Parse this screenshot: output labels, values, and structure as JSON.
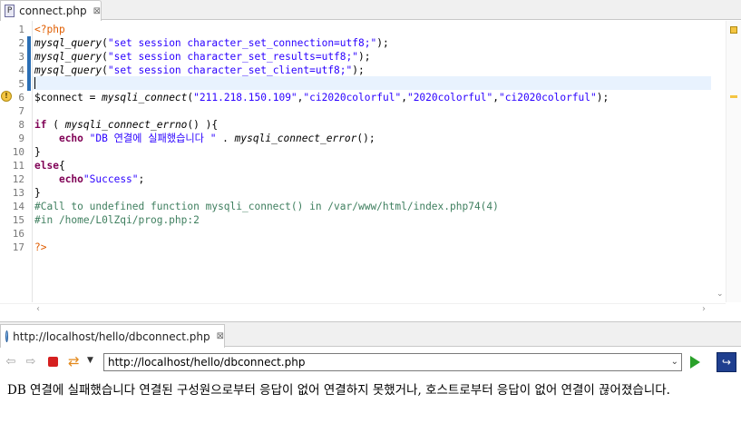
{
  "editor": {
    "tab_label": "connect.php",
    "tab_close_glyph": "⊠",
    "file_icon_letter": "P",
    "line_numbers": [
      "1",
      "2",
      "3",
      "4",
      "5",
      "6",
      "7",
      "8",
      "9",
      "10",
      "11",
      "12",
      "13",
      "14",
      "15",
      "16",
      "17"
    ],
    "lines": [
      [
        {
          "t": "<?php",
          "c": "tag"
        }
      ],
      [
        {
          "t": "mysql_query",
          "c": "fn"
        },
        {
          "t": "(",
          "c": "var"
        },
        {
          "t": "\"set session character_set_connection=utf8;\"",
          "c": "str"
        },
        {
          "t": ");",
          "c": "var"
        }
      ],
      [
        {
          "t": "mysql_query",
          "c": "fn"
        },
        {
          "t": "(",
          "c": "var"
        },
        {
          "t": "\"set session character_set_results=utf8;\"",
          "c": "str"
        },
        {
          "t": ");",
          "c": "var"
        }
      ],
      [
        {
          "t": "mysql_query",
          "c": "fn"
        },
        {
          "t": "(",
          "c": "var"
        },
        {
          "t": "\"set session character_set_client=utf8;\"",
          "c": "str"
        },
        {
          "t": ");",
          "c": "var"
        }
      ],
      [],
      [
        {
          "t": "$connect",
          "c": "var"
        },
        {
          "t": " = ",
          "c": "var"
        },
        {
          "t": "mysqli_connect",
          "c": "fn"
        },
        {
          "t": "(",
          "c": "var"
        },
        {
          "t": "\"211.218.150.109\"",
          "c": "str"
        },
        {
          "t": ",",
          "c": "var"
        },
        {
          "t": "\"ci2020colorful\"",
          "c": "str"
        },
        {
          "t": ",",
          "c": "var"
        },
        {
          "t": "\"2020colorful\"",
          "c": "str"
        },
        {
          "t": ",",
          "c": "var"
        },
        {
          "t": "\"ci2020colorful\"",
          "c": "str"
        },
        {
          "t": ");",
          "c": "var"
        }
      ],
      [],
      [
        {
          "t": "if",
          "c": "kw"
        },
        {
          "t": " ( ",
          "c": "var"
        },
        {
          "t": "mysqli_connect_errno",
          "c": "fn"
        },
        {
          "t": "() ){",
          "c": "var"
        }
      ],
      [
        {
          "t": "    ",
          "c": "var"
        },
        {
          "t": "echo",
          "c": "kw"
        },
        {
          "t": " ",
          "c": "var"
        },
        {
          "t": "\"DB 연결에 실패했습니다 \"",
          "c": "str"
        },
        {
          "t": " . ",
          "c": "var"
        },
        {
          "t": "mysqli_connect_error",
          "c": "fn"
        },
        {
          "t": "();",
          "c": "var"
        }
      ],
      [
        {
          "t": "}",
          "c": "var"
        }
      ],
      [
        {
          "t": "else",
          "c": "kw"
        },
        {
          "t": "{",
          "c": "var"
        }
      ],
      [
        {
          "t": "    ",
          "c": "var"
        },
        {
          "t": "echo",
          "c": "kw"
        },
        {
          "t": "\"Success\"",
          "c": "str"
        },
        {
          "t": ";",
          "c": "var"
        }
      ],
      [
        {
          "t": "}",
          "c": "var"
        }
      ],
      [
        {
          "t": "#Call to undefined function mysqli_connect() in /var/www/html/index.php74(4)",
          "c": "cmt"
        }
      ],
      [
        {
          "t": "#in /home/L0lZqi/prog.php:2",
          "c": "cmt"
        }
      ],
      [],
      [
        {
          "t": "?>",
          "c": "tag"
        }
      ]
    ]
  },
  "browser": {
    "tab_label": "http://localhost/hello/dbconnect.php",
    "tab_close_glyph": "⊠",
    "url_value": "http://localhost/hello/dbconnect.php",
    "back_glyph": "⇦",
    "forward_glyph": "⇨",
    "refresh_glyph": "⇄",
    "dropdown_glyph": "▼",
    "url_dropdown_glyph": "⌄",
    "open_external_glyph": "↪"
  },
  "page": {
    "message": "DB 연결에 실패했습니다 연결된 구성원으로부터 응답이 없어 연결하지 못했거나, 호스트로부터 응답이 없어 연결이 끊어졌습니다."
  },
  "colors": {
    "keyword": "#7f0055",
    "string": "#2a00ff",
    "comment": "#3f7f5f",
    "php_tag": "#e05d00",
    "current_line": "#e8f2fe"
  }
}
